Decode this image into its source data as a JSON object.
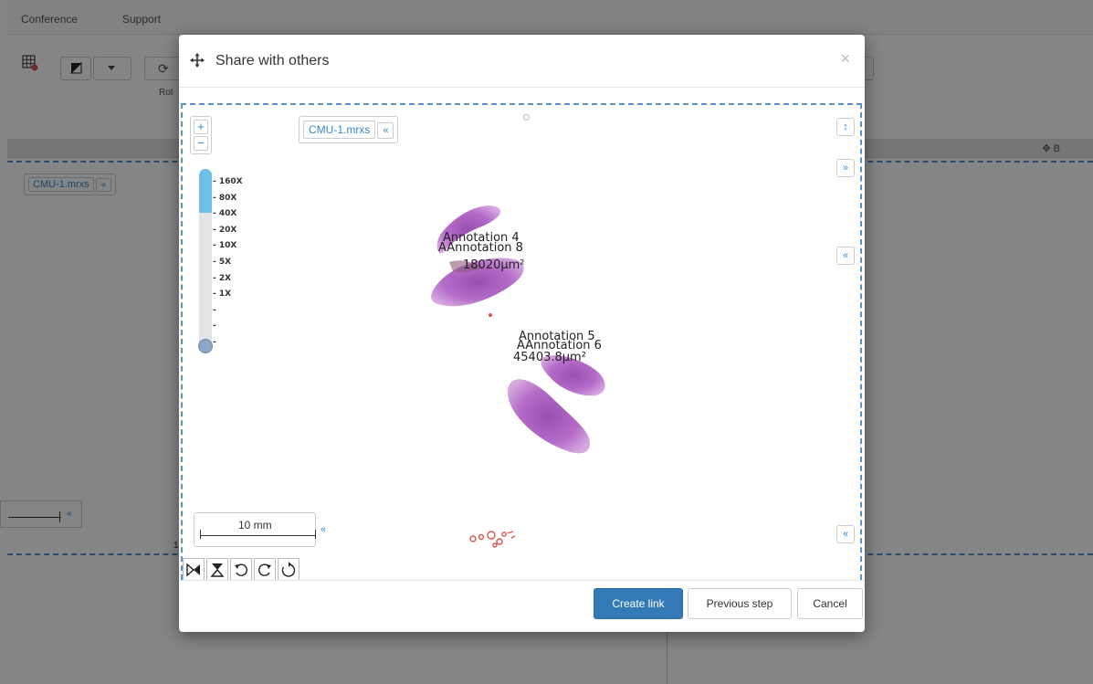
{
  "background": {
    "menu": [
      "Conference",
      "Support"
    ],
    "toolbar_partial_label": "Rot",
    "file_tag": {
      "name": "CMU-1.mrxs",
      "collapse": "«"
    },
    "scale_collapse": "«",
    "partial_digit": "1",
    "move_label": "✥ B"
  },
  "modal": {
    "title": "Share with others",
    "close": "×",
    "viewer": {
      "file_tag": {
        "name": "CMU-1.mrxs",
        "collapse": "«"
      },
      "zoom": {
        "plus": "+",
        "minus": "−",
        "levels": [
          "- 160X",
          "- 80X",
          "- 40X",
          "- 20X",
          "- 10X",
          "- 5X",
          "- 2X",
          "- 1X",
          "-",
          "-",
          "-"
        ],
        "current_fraction": 0.0
      },
      "side_buttons": [
        "↕",
        "»",
        "«",
        "«"
      ],
      "annotations": [
        {
          "text": "Annotation 4"
        },
        {
          "text": "AAnnotation 8"
        },
        {
          "text": "18020μm²"
        },
        {
          "text": "Annotation 5"
        },
        {
          "text": "AAnnotation 6"
        },
        {
          "text": "45403.8μm²"
        }
      ],
      "scalebar": {
        "label": "10 mm",
        "collapse": "«"
      },
      "rotation_icons": [
        "flip-horizontal-icon",
        "flip-vertical-icon",
        "rotate-left-icon",
        "rotate-right-icon",
        "rotate-reset-icon"
      ]
    },
    "footer": {
      "create": "Create link",
      "previous": "Previous step",
      "cancel": "Cancel"
    }
  }
}
